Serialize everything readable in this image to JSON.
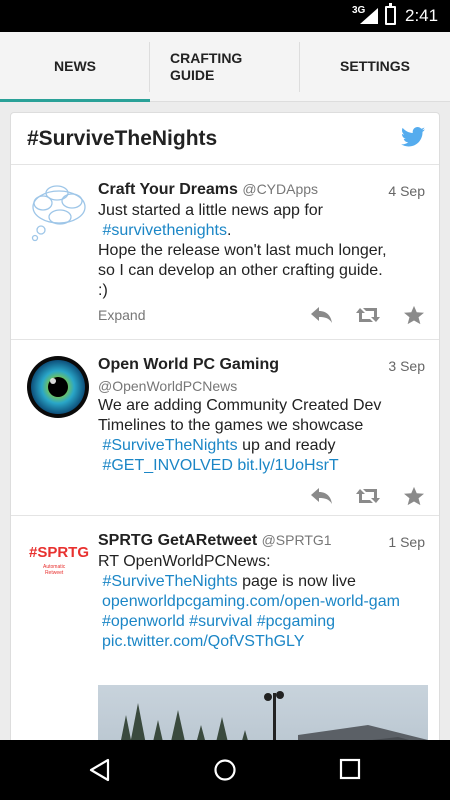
{
  "status_bar": {
    "network": "3G",
    "time": "2:41"
  },
  "tabs": [
    {
      "label": "NEWS",
      "active": true
    },
    {
      "label": "CRAFTING\nGUIDE",
      "active": false
    },
    {
      "label": "SETTINGS",
      "active": false
    }
  ],
  "feed": {
    "title": "#SurviveTheNights",
    "tweets": [
      {
        "name": "Craft Your Dreams",
        "handle": "@CYDApps",
        "date": "4 Sep",
        "line1": "Just started a little news app for",
        "hashtag": "#survivethenights",
        "hashtag_suffix": ".",
        "line3": "Hope the release won't last much longer,",
        "line4": "so I can develop an other crafting guide.",
        "line5": ":)",
        "expand": "Expand"
      },
      {
        "name": "Open World PC Gaming",
        "handle": "@OpenWorldPCNews",
        "date": "3 Sep",
        "line1": "We are adding Community Created Dev",
        "line2": "Timelines to the games we showcase",
        "hashtag": "#SurviveTheNights",
        "line3_suffix": " up and ready",
        "hashtag2": "#GET_INVOLVED",
        "link": "bit.ly/1UoHsrT"
      },
      {
        "name": "SPRTG GetARetweet",
        "handle": "@SPRTG1",
        "date": "1 Sep",
        "line1": "RT OpenWorldPCNews:",
        "hashtag": "#SurviveTheNights",
        "line2_suffix": " page is now live",
        "link": "openworldpcgaming.com/open-world-gam",
        "hashtags": "#openworld #survival #pcgaming",
        "pic": "pic.twitter.com/QofVSThGLY",
        "avatar_text": "#SPRTG",
        "avatar_sub": "Automatic\nRetweet"
      }
    ]
  },
  "colors": {
    "accent": "#2aa198",
    "link": "#1b86c6",
    "twitter": "#55acee"
  }
}
